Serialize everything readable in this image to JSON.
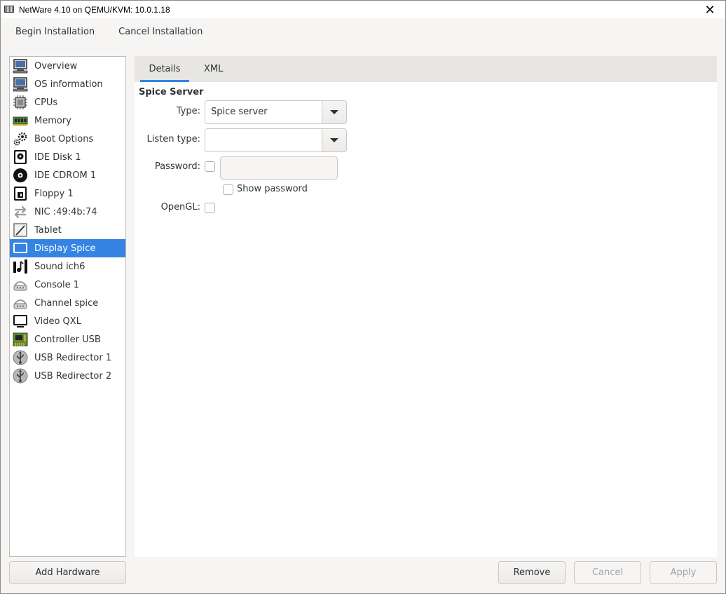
{
  "window": {
    "title": "NetWare 4.10 on QEMU/KVM: 10.0.1.18",
    "close_label": "✕"
  },
  "menubar": {
    "begin_label": "Begin Installation",
    "cancel_label": "Cancel Installation"
  },
  "sidebar": {
    "items": [
      {
        "label": "Overview",
        "icon": "monitor-icon"
      },
      {
        "label": "OS information",
        "icon": "monitor-icon"
      },
      {
        "label": "CPUs",
        "icon": "cpu-icon"
      },
      {
        "label": "Memory",
        "icon": "memory-icon"
      },
      {
        "label": "Boot Options",
        "icon": "gears-icon"
      },
      {
        "label": "IDE Disk 1",
        "icon": "disk-icon"
      },
      {
        "label": "IDE CDROM 1",
        "icon": "cdrom-icon"
      },
      {
        "label": "Floppy 1",
        "icon": "floppy-icon"
      },
      {
        "label": "NIC :49:4b:74",
        "icon": "network-icon"
      },
      {
        "label": "Tablet",
        "icon": "tablet-icon"
      },
      {
        "label": "Display Spice",
        "icon": "display-icon",
        "selected": true
      },
      {
        "label": "Sound ich6",
        "icon": "sound-icon"
      },
      {
        "label": "Console 1",
        "icon": "serial-icon"
      },
      {
        "label": "Channel spice",
        "icon": "serial-icon"
      },
      {
        "label": "Video QXL",
        "icon": "video-icon"
      },
      {
        "label": "Controller USB",
        "icon": "controller-icon"
      },
      {
        "label": "USB Redirector 1",
        "icon": "usb-icon"
      },
      {
        "label": "USB Redirector 2",
        "icon": "usb-icon"
      }
    ],
    "add_hardware_label": "Add Hardware"
  },
  "tabs": {
    "details_label": "Details",
    "xml_label": "XML"
  },
  "details": {
    "section_title": "Spice Server",
    "type_label": "Type:",
    "type_value": "Spice server",
    "listen_type_label": "Listen type:",
    "listen_type_value": "",
    "password_label": "Password:",
    "password_value": "",
    "show_password_label": "Show password",
    "opengl_label": "OpenGL:"
  },
  "buttons": {
    "remove_label": "Remove",
    "cancel_label": "Cancel",
    "apply_label": "Apply"
  },
  "colors": {
    "accent": "#3584e4",
    "background": "#f6f5f4"
  }
}
